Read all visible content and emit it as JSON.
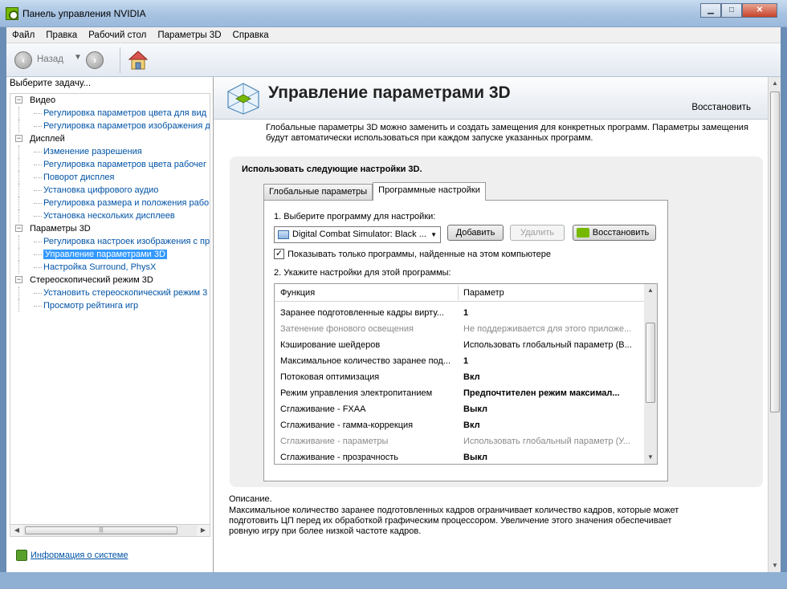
{
  "window": {
    "title": "Панель управления NVIDIA",
    "minimize": "▁",
    "maximize": "□",
    "close": "✕"
  },
  "menu": [
    "Файл",
    "Правка",
    "Рабочий стол",
    "Параметры 3D",
    "Справка"
  ],
  "toolbar": {
    "back_label": "Назад",
    "back_icon": "back-arrow-icon",
    "forward_icon": "forward-arrow-icon",
    "home_icon": "home-icon"
  },
  "left_pane": {
    "header": "Выберите задачу...",
    "tree": [
      {
        "label": "Видео",
        "children": [
          "Регулировка параметров цвета для вид",
          "Регулировка параметров изображения д"
        ]
      },
      {
        "label": "Дисплей",
        "children": [
          "Изменение разрешения",
          "Регулировка параметров цвета рабочег",
          "Поворот дисплея",
          "Установка цифрового аудио",
          "Регулировка размера и положения рабо",
          "Установка нескольких дисплеев"
        ]
      },
      {
        "label": "Параметры 3D",
        "children": [
          "Регулировка настроек изображения с пр",
          "Управление параметрами 3D",
          "Настройка Surround, PhysX"
        ]
      },
      {
        "label": "Стереоскопический режим 3D",
        "children": [
          "Установить стереоскопический режим 3",
          "Просмотр рейтинга игр"
        ]
      }
    ],
    "selected": "Управление параметрами 3D",
    "system_info_link": "Информация о системе"
  },
  "main": {
    "title": "Управление параметрами 3D",
    "restore_link": "Восстановить",
    "intro": "Глобальные параметры 3D можно заменить и создать замещения для конкретных программ. Параметры замещения будут автоматически использоваться при каждом запуске указанных программ.",
    "group_title": "Использовать следующие настройки 3D.",
    "tabs": [
      "Глобальные параметры",
      "Программные настройки"
    ],
    "active_tab": "Программные настройки",
    "step1": "1. Выберите программу для настройки:",
    "program_selected": "Digital Combat Simulator: Black ...",
    "add_button": "Добавить",
    "remove_button": "Удалить",
    "restore_button": "Восстановить",
    "checkbox_label": "Показывать только программы, найденные на этом компьютере",
    "checkbox_checked": true,
    "step2": "2. Укажите настройки для этой программы:",
    "grid_headers": [
      "Функция",
      "Параметр"
    ],
    "grid_rows": [
      {
        "feature": "Заранее подготовленные кадры вирту...",
        "value": "1",
        "dim": false,
        "bold": true
      },
      {
        "feature": "Затенение фонового освещения",
        "value": "Не поддерживается для этого приложе...",
        "dim": true,
        "bold": false
      },
      {
        "feature": "Кэширование шейдеров",
        "value": "Использовать глобальный параметр (В...",
        "dim": false,
        "bold": false
      },
      {
        "feature": "Максимальное количество заранее под...",
        "value": "1",
        "dim": false,
        "bold": true
      },
      {
        "feature": "Потоковая оптимизация",
        "value": "Вкл",
        "dim": false,
        "bold": true
      },
      {
        "feature": "Режим управления электропитанием",
        "value": "Предпочтителен режим максимал...",
        "dim": false,
        "bold": true
      },
      {
        "feature": "Сглаживание - FXAA",
        "value": "Выкл",
        "dim": false,
        "bold": true
      },
      {
        "feature": "Сглаживание - гамма-коррекция",
        "value": "Вкл",
        "dim": false,
        "bold": true
      },
      {
        "feature": "Сглаживание - параметры",
        "value": "Использовать глобальный параметр (У...",
        "dim": true,
        "bold": false
      },
      {
        "feature": "Сглаживание - прозрачность",
        "value": "Выкл",
        "dim": false,
        "bold": true
      }
    ],
    "description_label": "Описание.",
    "description_text": "Максимальное количество заранее подготовленных кадров ограничивает количество кадров, которые может подготовить ЦП перед их обработкой графическим процессором. Увеличение этого значения обеспечивает ровную игру при более низкой частоте кадров."
  },
  "colors": {
    "link": "#0053a6",
    "selection": "#3399ff",
    "nvidia_green": "#76b900"
  }
}
